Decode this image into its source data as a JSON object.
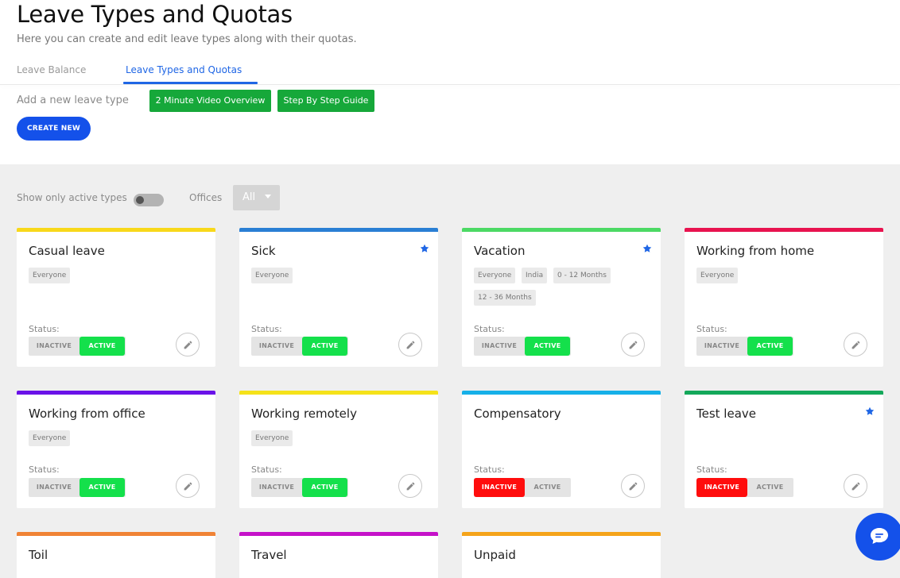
{
  "header": {
    "title": "Leave Types and Quotas",
    "subtitle": "Here you can create and edit leave types along with their quotas."
  },
  "tabs": [
    {
      "label": "Leave Balance",
      "active": false
    },
    {
      "label": "Leave Types and Quotas",
      "active": true
    }
  ],
  "actions": {
    "add_label": "Add a new leave type",
    "video_button": "2 Minute Video Overview",
    "guide_button": "Step By Step Guide",
    "create_button": "CREATE NEW"
  },
  "filters": {
    "active_toggle_label": "Show only active types",
    "active_toggle_on": false,
    "offices_label": "Offices",
    "offices_value": "All"
  },
  "card_labels": {
    "status": "Status:",
    "inactive": "INACTIVE",
    "active": "ACTIVE"
  },
  "leave_types": [
    {
      "name": "Casual leave",
      "color": "#f8d81b",
      "starred": false,
      "chips": [
        "Everyone"
      ],
      "status": "active"
    },
    {
      "name": "Sick",
      "color": "#2a7fd4",
      "starred": true,
      "chips": [
        "Everyone"
      ],
      "status": "active"
    },
    {
      "name": "Vacation",
      "color": "#4cd964",
      "starred": true,
      "chips": [
        "Everyone",
        "India",
        "0 - 12 Months",
        "12 - 36 Months"
      ],
      "status": "active"
    },
    {
      "name": "Working from home",
      "color": "#e8134f",
      "starred": false,
      "chips": [
        "Everyone"
      ],
      "status": "active"
    },
    {
      "name": "Working from office",
      "color": "#6a12e8",
      "starred": false,
      "chips": [
        "Everyone"
      ],
      "status": "active"
    },
    {
      "name": "Working remotely",
      "color": "#f5e21a",
      "starred": false,
      "chips": [
        "Everyone"
      ],
      "status": "active"
    },
    {
      "name": "Compensatory",
      "color": "#16b0e8",
      "starred": false,
      "chips": [],
      "status": "inactive"
    },
    {
      "name": "Test leave",
      "color": "#14a85a",
      "starred": true,
      "chips": [],
      "status": "inactive"
    },
    {
      "name": "Toil",
      "color": "#f08335",
      "starred": false,
      "chips": [],
      "status": null
    },
    {
      "name": "Travel",
      "color": "#c512c9",
      "starred": false,
      "chips": [],
      "status": null
    },
    {
      "name": "Unpaid",
      "color": "#f5a41a",
      "starred": false,
      "chips": [],
      "status": null
    }
  ],
  "colors": {
    "primary": "#1451ea",
    "green_button": "#16a83a",
    "active_green": "#14e04b",
    "inactive_red": "#ff0d0d",
    "star_blue": "#1f66e5"
  },
  "icons": {
    "star": "star-icon",
    "edit": "pencil-icon",
    "chat": "chat-bubble-icon",
    "caret": "caret-down-icon"
  }
}
